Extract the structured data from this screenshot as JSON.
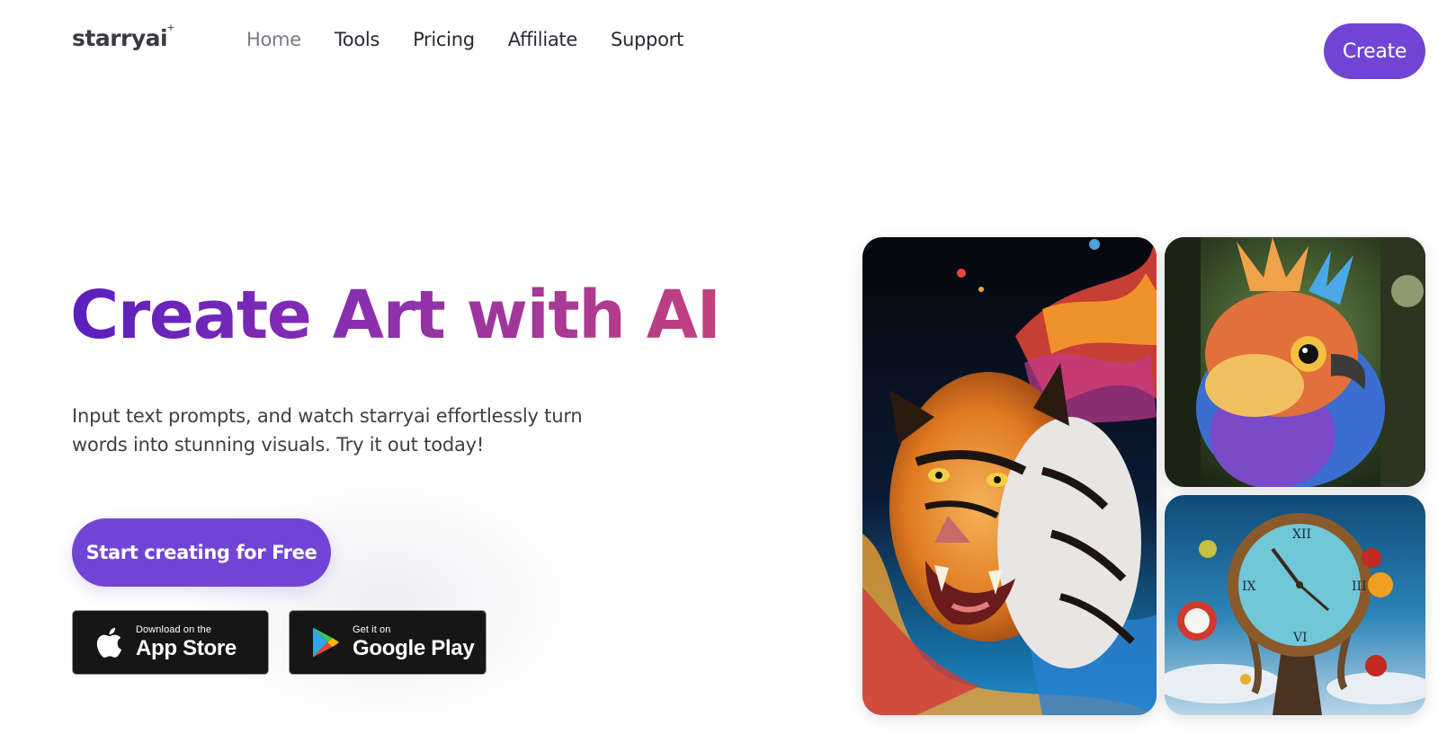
{
  "brand": {
    "logo_text": "starryai",
    "logo_spark": "+"
  },
  "nav": {
    "items": [
      {
        "label": "Home",
        "active": true
      },
      {
        "label": "Tools",
        "active": false
      },
      {
        "label": "Pricing",
        "active": false
      },
      {
        "label": "Affiliate",
        "active": false
      },
      {
        "label": "Support",
        "active": false
      }
    ]
  },
  "header": {
    "create_label": "Create"
  },
  "hero": {
    "title": "Create Art with AI",
    "subtitle": "Input text prompts, and watch starryai effortlessly turn words into stunning visuals. Try it out today!",
    "cta_label": "Start creating for Free"
  },
  "stores": {
    "apple": {
      "small": "Download on the",
      "big": "App Store",
      "icon": "apple-logo-icon"
    },
    "google": {
      "small": "Get it on",
      "big": "Google Play",
      "icon": "google-play-icon"
    }
  },
  "gallery": [
    {
      "name": "tiger-art"
    },
    {
      "name": "bird-art"
    },
    {
      "name": "clock-art"
    }
  ],
  "colors": {
    "accent": "#7045d6",
    "gradient_start": "#5a1fbf",
    "gradient_end": "#c2417c",
    "store_bg": "#161616"
  }
}
